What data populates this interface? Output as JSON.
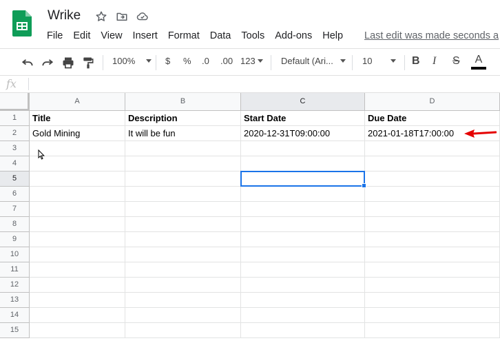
{
  "app": {
    "doc_title": "Wrike",
    "last_edit": "Last edit was made seconds a"
  },
  "menu": [
    "File",
    "Edit",
    "View",
    "Insert",
    "Format",
    "Data",
    "Tools",
    "Add-ons",
    "Help"
  ],
  "toolbar": {
    "zoom": "100%",
    "currency": "$",
    "percent": "%",
    "decimal_decrease": ".0",
    "decimal_increase": ".00",
    "more_formats": "123",
    "font": "Default (Ari...",
    "font_size": "10",
    "bold": "B",
    "italic": "I",
    "strike": "S",
    "text_color": "A"
  },
  "formula_bar": {
    "fx": "fx",
    "value": ""
  },
  "columns": [
    "A",
    "B",
    "C",
    "D"
  ],
  "rows": [
    "1",
    "2",
    "3",
    "4",
    "5",
    "6",
    "7",
    "8",
    "9",
    "10",
    "11",
    "12",
    "13",
    "14",
    "15"
  ],
  "cells": [
    [
      "Title",
      "Description",
      "Start Date",
      "Due Date"
    ],
    [
      "Gold Mining",
      "It will be fun",
      "2020-12-31T09:00:00",
      "2021-01-18T17:00:00"
    ]
  ],
  "selected_cell": "C5",
  "colors": {
    "accent": "#1a73e8",
    "annotation_arrow": "#e50000",
    "sheets_green": "#0f9d58"
  }
}
